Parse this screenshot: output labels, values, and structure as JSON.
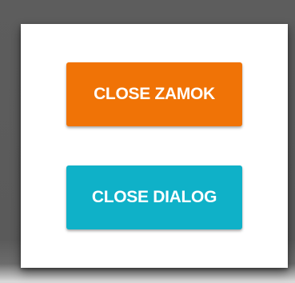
{
  "dialog": {
    "buttons": {
      "close_zamok": {
        "label": "CLOSE ZAMOK",
        "color": "#f07306"
      },
      "close_dialog": {
        "label": "CLOSE DIALOG",
        "color": "#0fb1c8"
      }
    }
  },
  "colors": {
    "backdrop": "#5d5d5d",
    "dialog_background": "#ffffff",
    "button_text": "#ffffff"
  }
}
